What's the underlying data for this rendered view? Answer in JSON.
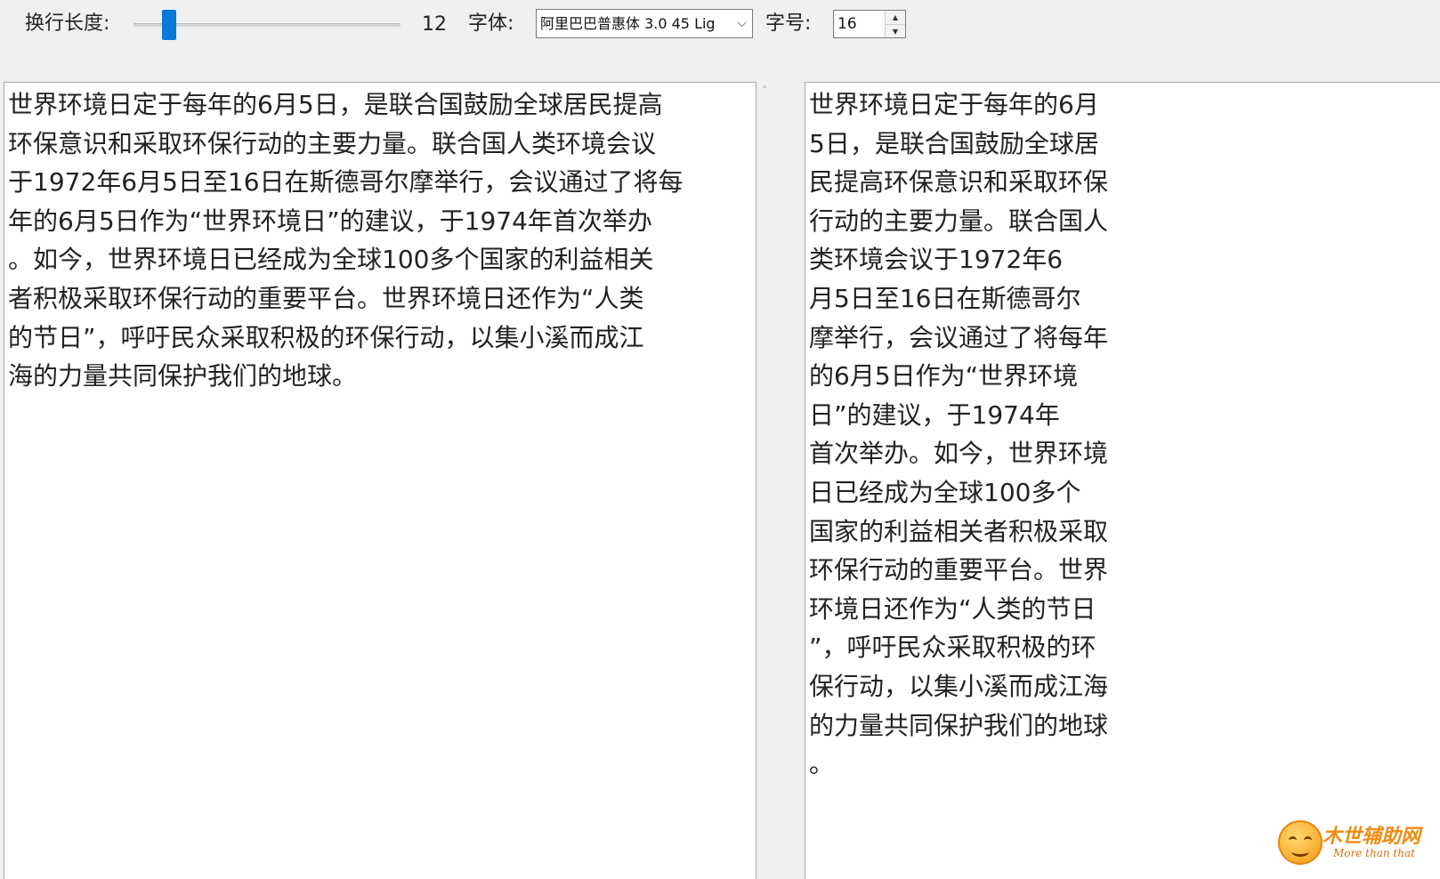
{
  "toolbar": {
    "wrap_length_label": "换行长度:",
    "wrap_length_value": "12",
    "wrap_length_slider": {
      "min": 1,
      "max": 100,
      "value": 12
    },
    "font_label": "字体:",
    "font_value": "阿里巴巴普惠体 3.0 45 Lig",
    "font_dropdown_icon": "chevron-down-icon",
    "size_label": "字号:",
    "size_value": "16"
  },
  "left_pane": {
    "text": "世界环境日定于每年的6月5日，是联合国鼓励全球居民提高\n环保意识和采取环保行动的主要力量。联合国人类环境会议\n于1972年6月5日至16日在斯德哥尔摩举行，会议通过了将每\n年的6月5日作为“世界环境日”的建议，于1974年首次举办\n。如今，世界环境日已经成为全球100多个国家的利益相关\n者积极采取环保行动的重要平台。世界环境日还作为“人类\n的节日”，呼吁民众采取积极的环保行动，以集小溪而成江\n海的力量共同保护我们的地球。"
  },
  "right_pane": {
    "text": "世界环境日定于每年的6月\n5日，是联合国鼓励全球居\n民提高环保意识和采取环保\n行动的主要力量。联合国人\n类环境会议于1972年6\n月5日至16日在斯德哥尔\n摩举行，会议通过了将每年\n的6月5日作为“世界环境\n日”的建议，于1974年\n首次举办。如今，世界环境\n日已经成为全球100多个\n国家的利益相关者积极采取\n环保行动的重要平台。世界\n环境日还作为“人类的节日\n”，呼吁民众采取积极的环\n保行动，以集小溪而成江海\n的力量共同保护我们的地球\n。"
  },
  "watermark": {
    "title": "木世辅助网",
    "subtitle": "More than that"
  },
  "colors": {
    "accent": "#0a78d7",
    "watermark": "#f08c10"
  }
}
